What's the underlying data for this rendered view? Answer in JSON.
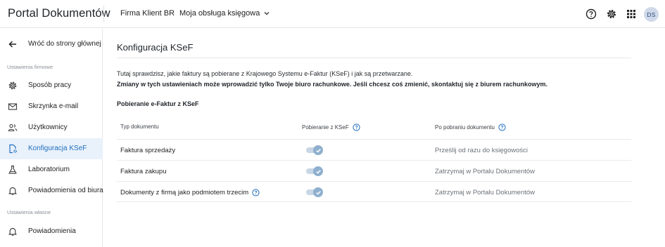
{
  "header": {
    "app_title": "Portal Dokumentów",
    "client_name": "Firma Klient BR",
    "account_selector": "Moja obsługa księgowa",
    "avatar_initials": "DS",
    "icons": [
      "help-circle-icon",
      "gear-icon",
      "apps-grid-icon"
    ]
  },
  "sidebar": {
    "back_label": "Wróć do strony głównej",
    "section_company": "Ustawienia firmowe",
    "items": [
      {
        "label": "Sposób pracy",
        "icon": "gear-icon"
      },
      {
        "label": "Skrzynka e-mail",
        "icon": "mail-icon"
      },
      {
        "label": "Użytkownicy",
        "icon": "users-icon"
      },
      {
        "label": "Konfiguracja KSeF",
        "icon": "document-settings-icon",
        "active": true
      },
      {
        "label": "Laboratorium",
        "icon": "flask-icon"
      },
      {
        "label": "Powiadomienia od biura",
        "icon": "bell-icon"
      }
    ],
    "section_own": "Ustawienia własne",
    "own_items": [
      {
        "label": "Powiadomienia",
        "icon": "bell-icon"
      }
    ]
  },
  "main": {
    "title": "Konfiguracja KSeF",
    "intro": "Tutaj sprawdzisz, jakie faktury są pobierane z Krajowego Systemu e-Faktur (KSeF) i jak są przetwarzane.",
    "intro_bold": "Zmiany w tych ustawieniach może wprowadzić tylko Twoje biuro rachunkowe. Jeśli chcesz coś zmienić, skontaktuj się z biurem rachunkowym.",
    "section_title": "Pobieranie e-Faktur z KSeF",
    "table": {
      "headers": {
        "doc_type": "Typ dokumentu",
        "download": "Pobieranie z KSeF",
        "after": "Po pobraniu dokumentu"
      },
      "rows": [
        {
          "doc_type": "Faktura sprzedaży",
          "enabled": true,
          "after": "Prześlij od razu do księgowości"
        },
        {
          "doc_type": "Faktura zakupu",
          "enabled": true,
          "after": "Zatrzymaj w Portalu Dokumentów"
        },
        {
          "doc_type": "Dokumenty z firmą jako podmiotem trzecim",
          "enabled": true,
          "after": "Zatrzymaj w Portalu Dokumentów",
          "has_help": true
        }
      ]
    }
  },
  "colors": {
    "accent": "#1f6fbf",
    "active_bg": "#e9f1fb",
    "toggle_track": "#c8d6e5",
    "toggle_knob": "#8fb0cf"
  }
}
